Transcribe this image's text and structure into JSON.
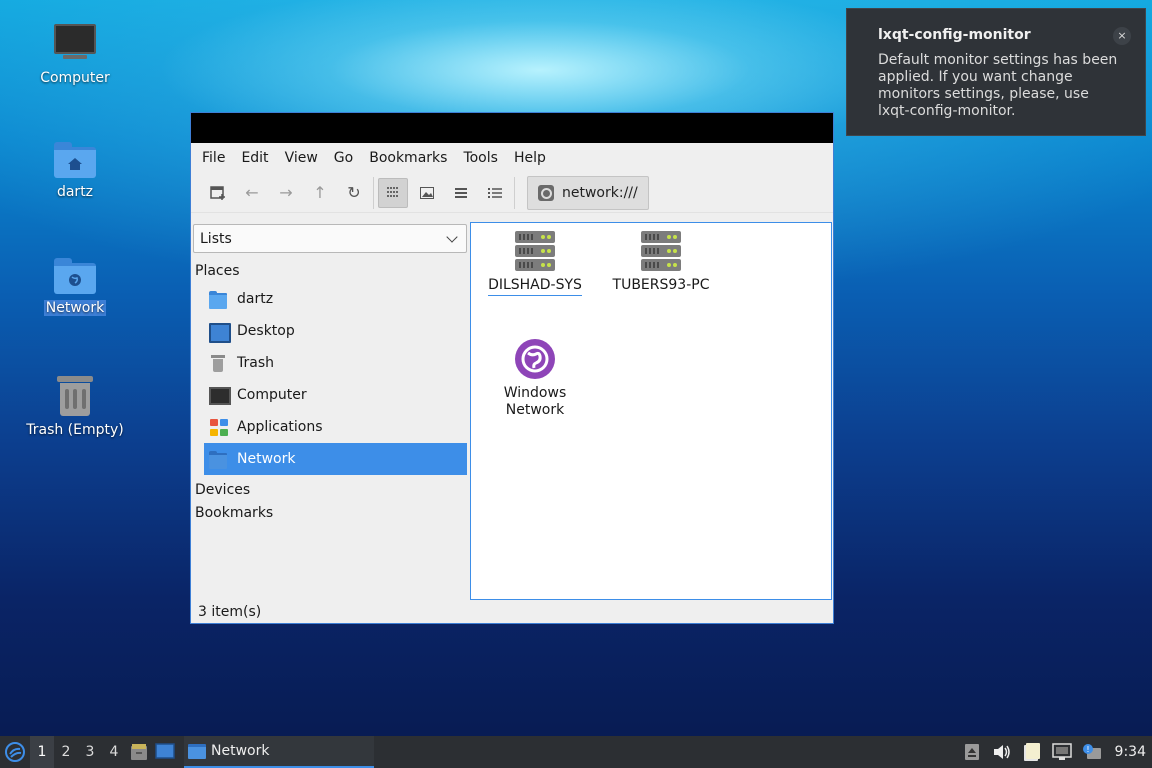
{
  "desktop": {
    "icons": [
      {
        "label": "Computer"
      },
      {
        "label": "dartz"
      },
      {
        "label": "Network"
      },
      {
        "label": "Trash (Empty)"
      }
    ]
  },
  "notification": {
    "title": "lxqt-config-monitor",
    "message": "Default monitor settings has been applied. If you want change monitors settings, please, use lxqt-config-monitor.",
    "close": "×"
  },
  "window": {
    "menu": [
      "File",
      "Edit",
      "View",
      "Go",
      "Bookmarks",
      "Tools",
      "Help"
    ],
    "path": "network:///",
    "side_combo": "Lists",
    "places_header": "Places",
    "places": [
      {
        "label": "dartz"
      },
      {
        "label": "Desktop"
      },
      {
        "label": "Trash"
      },
      {
        "label": "Computer"
      },
      {
        "label": "Applications"
      },
      {
        "label": "Network"
      }
    ],
    "devices_header": "Devices",
    "bookmarks_header": "Bookmarks",
    "items": [
      {
        "label": "DILSHAD-SYS"
      },
      {
        "label": "TUBERS93-PC"
      },
      {
        "label": "Windows Network"
      }
    ],
    "status": "3 item(s)"
  },
  "taskbar": {
    "workspaces": [
      "1",
      "2",
      "3",
      "4"
    ],
    "task_label": "Network",
    "clock": "9:34"
  },
  "colors": {
    "accent": "#3d8ee8",
    "panel": "#2c2f33",
    "notification_bg": "#2f3338"
  }
}
